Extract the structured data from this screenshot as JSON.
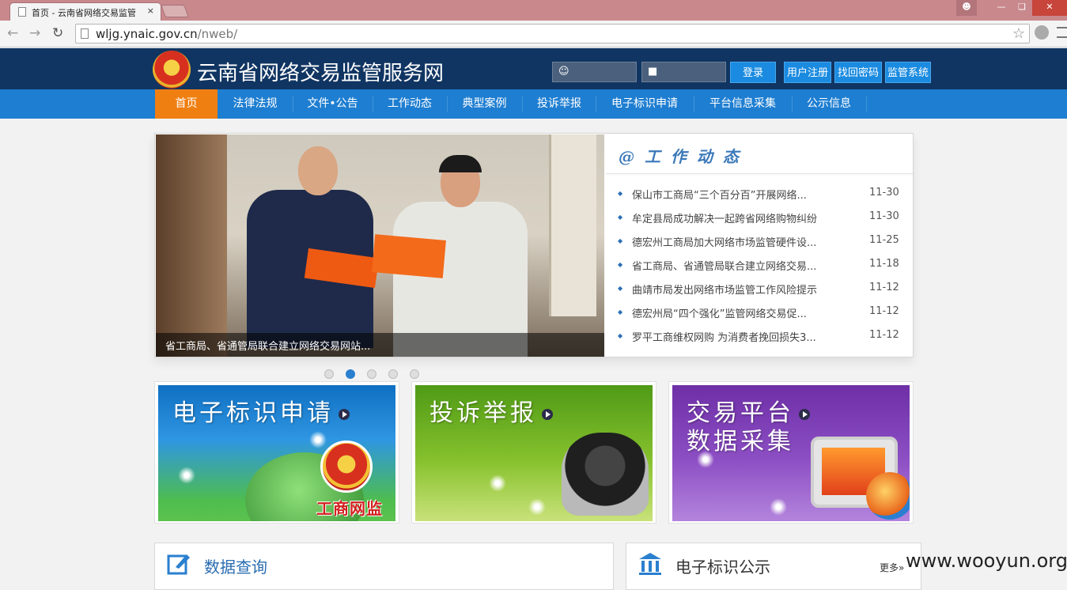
{
  "browser": {
    "tab_title": "首页 - 云南省网络交易监管",
    "tab_close": "×",
    "url_host": "wljg.ynaic.gov.cn",
    "url_path": "/nweb/"
  },
  "header": {
    "site_title": "云南省网络交易监管服务网",
    "username_placeholder": "",
    "password_placeholder": "",
    "login_label": "登录",
    "register_label": "用户注册",
    "recover_label": "找回密码",
    "system_label": "监管系统"
  },
  "nav": {
    "items": [
      "首页",
      "法律法规",
      "文件•公告",
      "工作动态",
      "典型案例",
      "投诉举报",
      "电子标识申请",
      "平台信息采集",
      "公示信息"
    ]
  },
  "slider": {
    "caption": "省工商局、省通管局联合建立网络交易网站...",
    "active_index": 1,
    "count": 5
  },
  "news": {
    "title": "@ 工 作 动 态",
    "items": [
      {
        "text": "保山市工商局“三个百分百”开展网络...",
        "date": "11-30"
      },
      {
        "text": "牟定县局成功解决一起跨省网络购物纠纷",
        "date": "11-30"
      },
      {
        "text": "德宏州工商局加大网络市场监管硬件设...",
        "date": "11-25"
      },
      {
        "text": "省工商局、省通管局联合建立网络交易...",
        "date": "11-18"
      },
      {
        "text": "曲靖市局发出网络市场监管工作风险提示",
        "date": "11-12"
      },
      {
        "text": "德宏州局“四个强化”监管网络交易促...",
        "date": "11-12"
      },
      {
        "text": "罗平工商维权网购 为消费者挽回损失3...",
        "date": "11-12"
      }
    ]
  },
  "cards": {
    "c1": {
      "line1": "电子标识申请",
      "seal_text": "工商网监"
    },
    "c2": {
      "line1": "投诉举报"
    },
    "c3": {
      "line1": "交易平台",
      "line2": "数据采集"
    }
  },
  "panels": {
    "left_title": "数据查询",
    "right_title": "电子标识公示",
    "more_label": "更多»"
  },
  "watermark": "www.wooyun.org",
  "colors": {
    "header_bg": "#103562",
    "nav_bg": "#1e7ed1",
    "nav_active": "#f07f12",
    "button": "#1a8be0"
  }
}
